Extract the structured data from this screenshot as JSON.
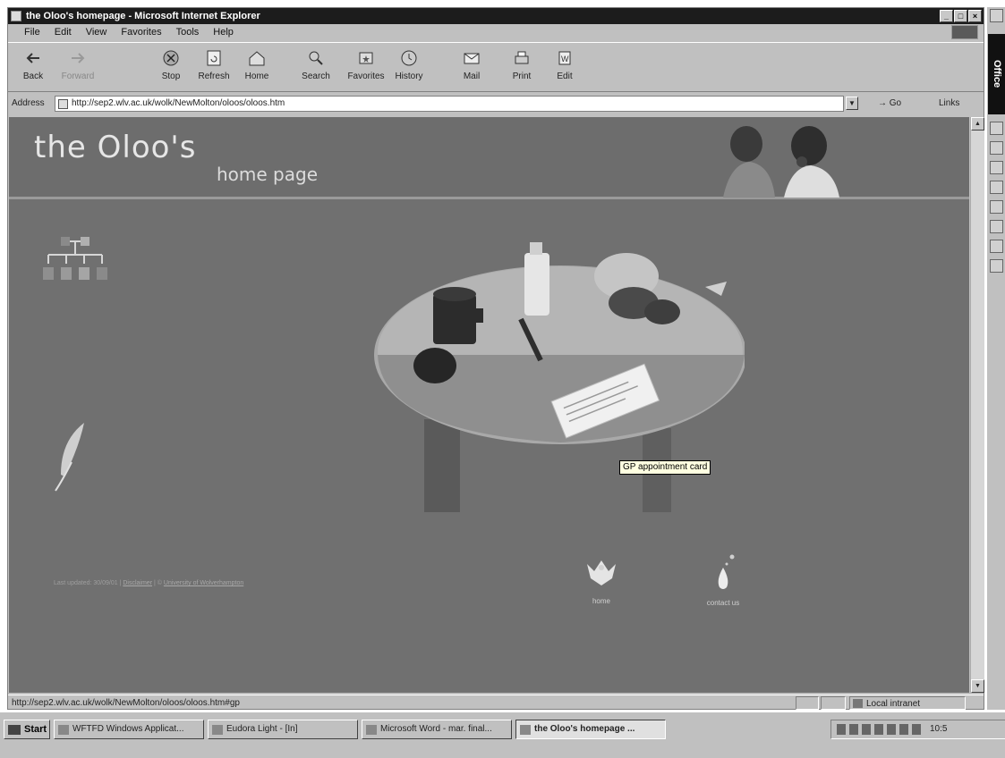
{
  "window": {
    "title": "the Oloo's homepage - Microsoft Internet Explorer",
    "controls": [
      "_",
      "□",
      "×"
    ]
  },
  "menu": [
    "File",
    "Edit",
    "View",
    "Favorites",
    "Tools",
    "Help"
  ],
  "toolbar": [
    {
      "label": "Back",
      "icon": "back-arrow-icon",
      "disabled": false
    },
    {
      "label": "Forward",
      "icon": "forward-arrow-icon",
      "disabled": true
    },
    {
      "label": "Stop",
      "icon": "stop-icon",
      "disabled": false
    },
    {
      "label": "Refresh",
      "icon": "refresh-icon",
      "disabled": false
    },
    {
      "label": "Home",
      "icon": "home-icon",
      "disabled": false
    },
    {
      "label": "Search",
      "icon": "search-icon",
      "disabled": false
    },
    {
      "label": "Favorites",
      "icon": "favorites-icon",
      "disabled": false
    },
    {
      "label": "History",
      "icon": "history-icon",
      "disabled": false
    },
    {
      "label": "Mail",
      "icon": "mail-icon",
      "disabled": false
    },
    {
      "label": "Print",
      "icon": "print-icon",
      "disabled": false
    },
    {
      "label": "Edit",
      "icon": "edit-icon",
      "disabled": false
    }
  ],
  "address": {
    "label": "Address",
    "url": "http://sep2.wlv.ac.uk/wolk/NewMolton/oloos/oloos.htm",
    "go_label": "Go",
    "links_label": "Links"
  },
  "page": {
    "title": "the Oloo's",
    "subtitle": "home page",
    "tooltip": "GP appointment card",
    "footer": {
      "updated": "Last updated: 30/09/01",
      "disclaimer": "Disclaimer",
      "separator": "|",
      "copyright_mark": "©",
      "copyright_link": "University of Wolverhampton"
    },
    "home_label": "home",
    "contact_label": "contact us"
  },
  "status": {
    "text": "http://sep2.wlv.ac.uk/wolk/NewMolton/oloos/oloos.htm#gp",
    "zone": "Local intranet"
  },
  "officebar": {
    "label": "Office"
  },
  "taskbar": {
    "start": "Start",
    "items": [
      {
        "label": "WFTFD Windows Applicat...",
        "active": false
      },
      {
        "label": "Eudora Light - [In]",
        "active": false
      },
      {
        "label": "Microsoft Word - mar. final...",
        "active": false
      },
      {
        "label": "the Oloo's homepage ...",
        "active": true
      }
    ],
    "clock": "10:5"
  },
  "colors": {
    "page_bg": "#707070",
    "header_bg": "#6d6d6d",
    "titlebar": "#1c1c1c",
    "chrome": "#c0c0c0",
    "tooltip_bg": "#ffffe1"
  }
}
